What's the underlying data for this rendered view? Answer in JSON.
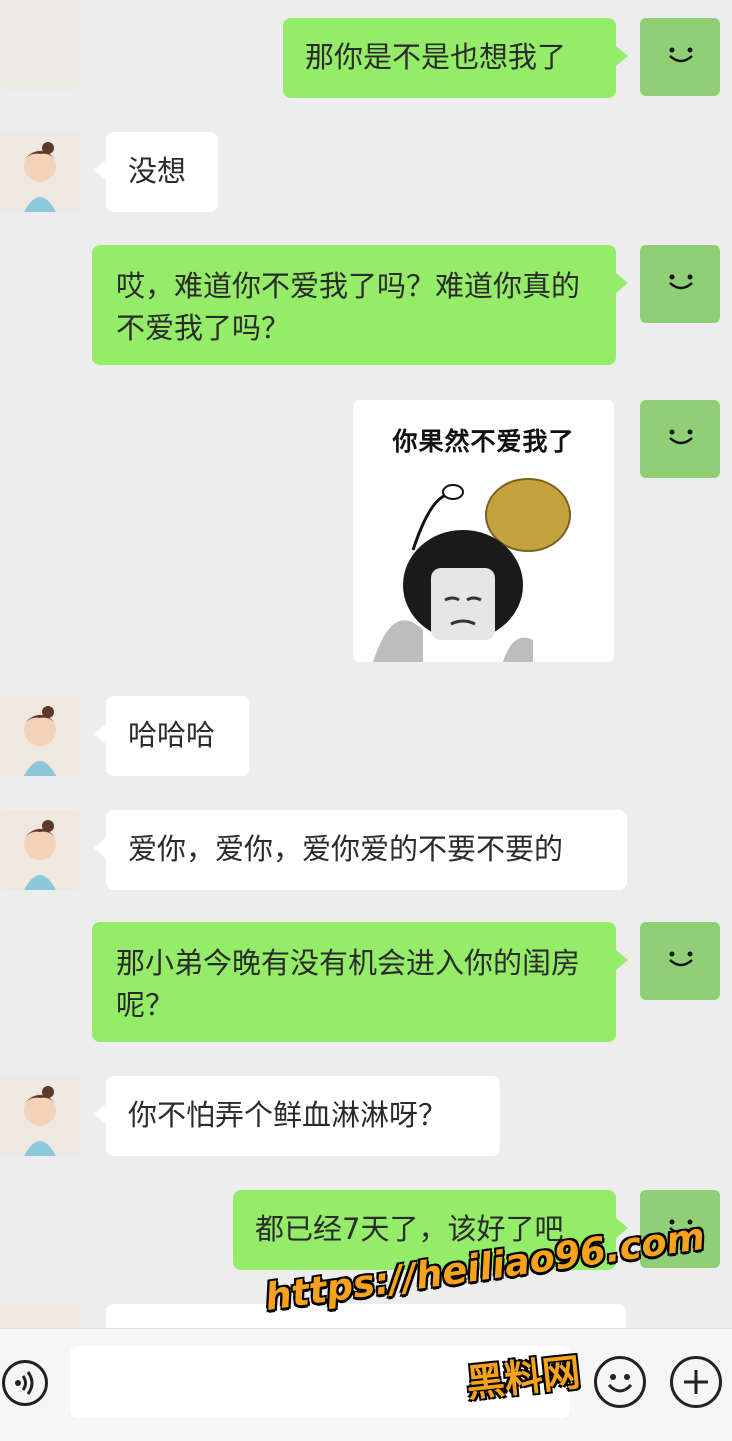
{
  "messages": [
    {
      "from": "me",
      "text": "那你是不是也想我了"
    },
    {
      "from": "them",
      "text": "没想"
    },
    {
      "from": "me",
      "text": "哎，难道你不爱我了吗？难道你真的不爱我了吗？"
    },
    {
      "from": "me",
      "type": "sticker",
      "caption": "你果然不爱我了"
    },
    {
      "from": "them",
      "text": "哈哈哈"
    },
    {
      "from": "them",
      "text": "爱你，爱你，爱你爱的不要不要的"
    },
    {
      "from": "me",
      "text": "那小弟今晚有没有机会进入你的闺房呢？"
    },
    {
      "from": "them",
      "text": "你不怕弄个鲜血淋淋呀？"
    },
    {
      "from": "me",
      "text": "都已经7天了，该好了吧"
    }
  ],
  "input_bar": {
    "voice_icon": "voice-icon",
    "emoji_icon": "emoji-icon",
    "plus_icon": "plus-icon"
  },
  "watermark": {
    "url": "https://heiliao96.com",
    "name": "黑料网"
  },
  "colors": {
    "my_bubble": "#95ec69",
    "their_bubble": "#ffffff",
    "background": "#ededed",
    "watermark": "#f6a21c"
  }
}
